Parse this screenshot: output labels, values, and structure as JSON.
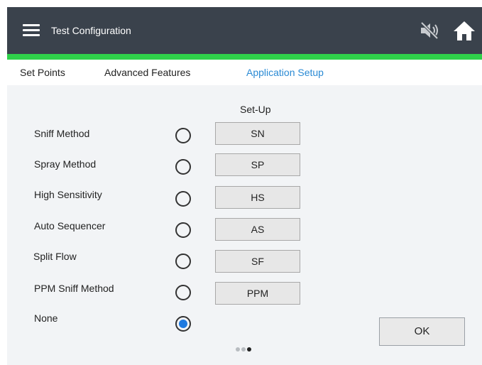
{
  "header": {
    "title": "Test Configuration",
    "menu_icon": "hamburger-menu-icon",
    "mute_icon": "speaker-muted-icon",
    "home_icon": "home-icon",
    "bg_color": "#3a424c",
    "accent_color": "#2fd14a"
  },
  "tabs": [
    {
      "label": "Set Points",
      "active": false
    },
    {
      "label": "Advanced Features",
      "active": false
    },
    {
      "label": "Application Setup",
      "active": true
    }
  ],
  "main": {
    "section_title": "Set-Up",
    "options": [
      {
        "label": "Sniff Method",
        "code": "SN",
        "selected": false
      },
      {
        "label": "Spray Method",
        "code": "SP",
        "selected": false
      },
      {
        "label": "High Sensitivity",
        "code": "HS",
        "selected": false
      },
      {
        "label": "Auto Sequencer",
        "code": "AS",
        "selected": false
      },
      {
        "label": "Split Flow",
        "code": "SF",
        "selected": false
      },
      {
        "label": "PPM Sniff Method",
        "code": "PPM",
        "selected": false
      },
      {
        "label": "None",
        "selected": true
      }
    ],
    "ok_label": "OK",
    "pager": {
      "pages": 3,
      "current": 3
    },
    "selected_color": "#1e7ae0"
  }
}
